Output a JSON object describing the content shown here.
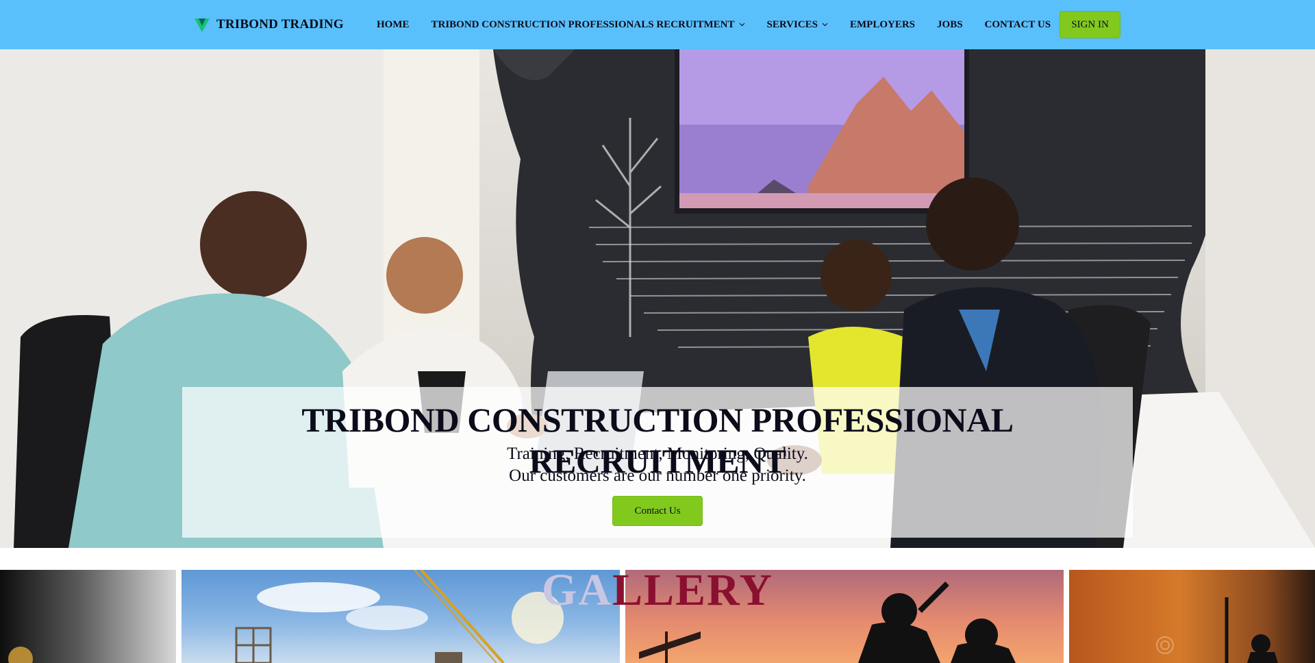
{
  "header": {
    "logo_text": "TRIBOND TRADING",
    "logo_icon": "v-leaf-icon",
    "nav": [
      {
        "label": "HOME",
        "dropdown": false
      },
      {
        "label": "TRIBOND CONSTRUCTION PROFESSIONALS RECRUITMENT",
        "dropdown": true
      },
      {
        "label": "SERVICES",
        "dropdown": true
      },
      {
        "label": "EMPLOYERS",
        "dropdown": false
      },
      {
        "label": "JOBS",
        "dropdown": false
      },
      {
        "label": "CONTACT US",
        "dropdown": false
      }
    ],
    "signin_label": "SIGN IN",
    "colors": {
      "bar": "#5ac0fc",
      "button": "#82c91e"
    }
  },
  "hero": {
    "title": "TRIBOND CONSTRUCTION PROFESSIONAL RECRUITMENT",
    "subtitle_line1": "Training, Recruitment, Monitoring, Quality.",
    "subtitle_line2": "Our customers are our number one priority.",
    "button_label": "Contact Us"
  },
  "gallery": {
    "title_part1": "GA",
    "title_part2": "LLERY"
  }
}
